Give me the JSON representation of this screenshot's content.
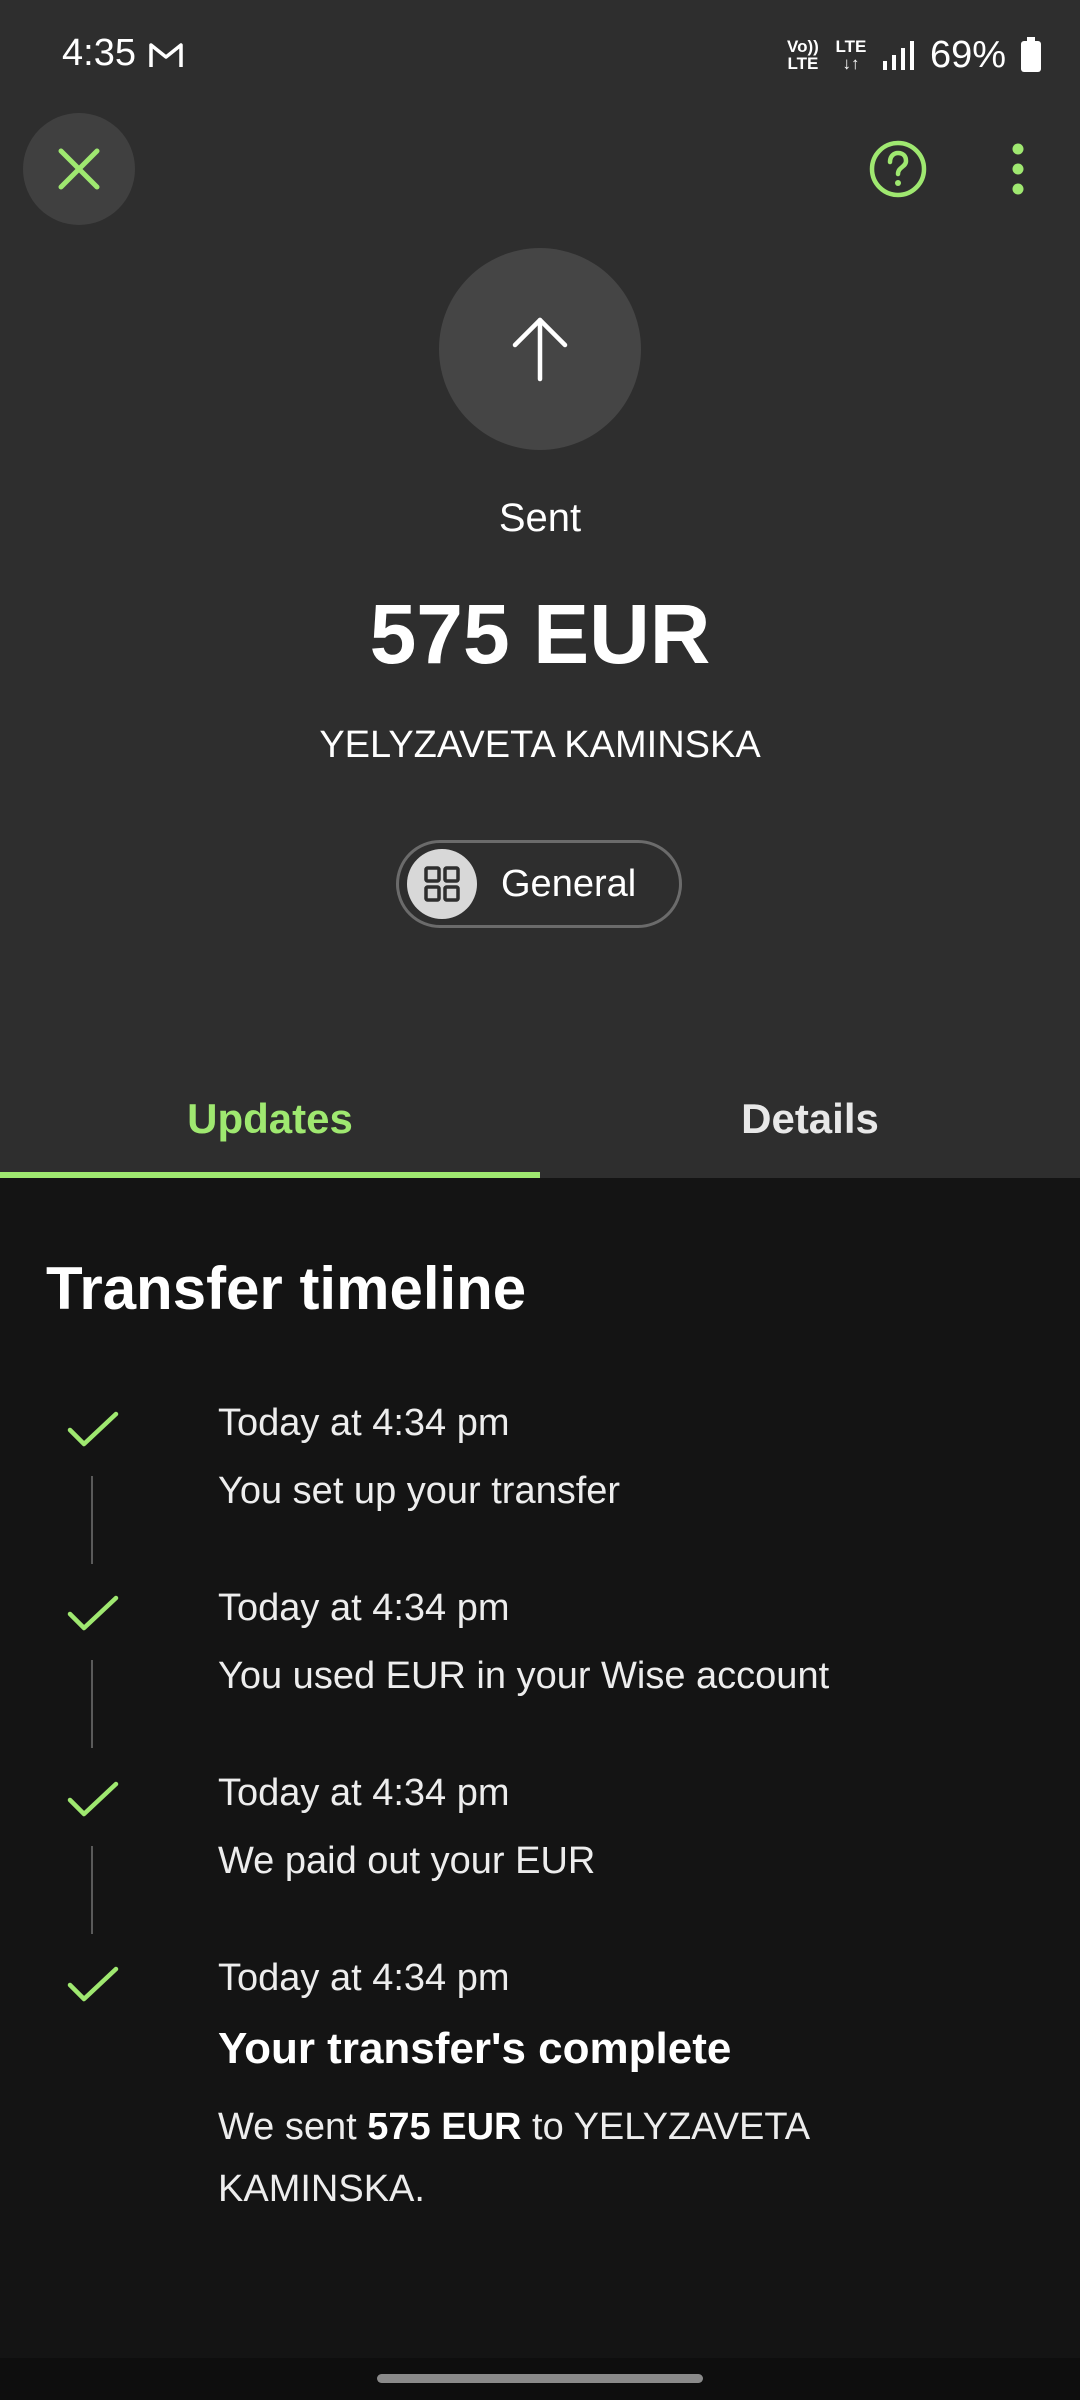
{
  "status_bar": {
    "time": "4:35",
    "net_top": "Vo)) LTE",
    "net_mid": "LTE",
    "battery": "69%"
  },
  "header": {
    "status_label": "Sent",
    "amount": "575 EUR",
    "recipient": "YELYZAVETA KAMINSKA",
    "category": "General"
  },
  "tabs": {
    "updates": "Updates",
    "details": "Details",
    "active": "updates"
  },
  "timeline": {
    "title": "Transfer timeline",
    "events": [
      {
        "time": "Today at 4:34 pm",
        "description": "You set up your transfer"
      },
      {
        "time": "Today at 4:34 pm",
        "description": "You used EUR in your Wise account"
      },
      {
        "time": "Today at 4:34 pm",
        "description": "We paid out your EUR"
      },
      {
        "time": "Today at 4:34 pm",
        "heading": "Your transfer's complete",
        "body_prefix": "We sent ",
        "body_amount": "575 EUR",
        "body_suffix": " to YELYZAVETA KAMINSKA."
      }
    ]
  },
  "colors": {
    "accent": "#9fe870",
    "header_bg": "#2e2e2e",
    "body_bg": "#141414"
  }
}
